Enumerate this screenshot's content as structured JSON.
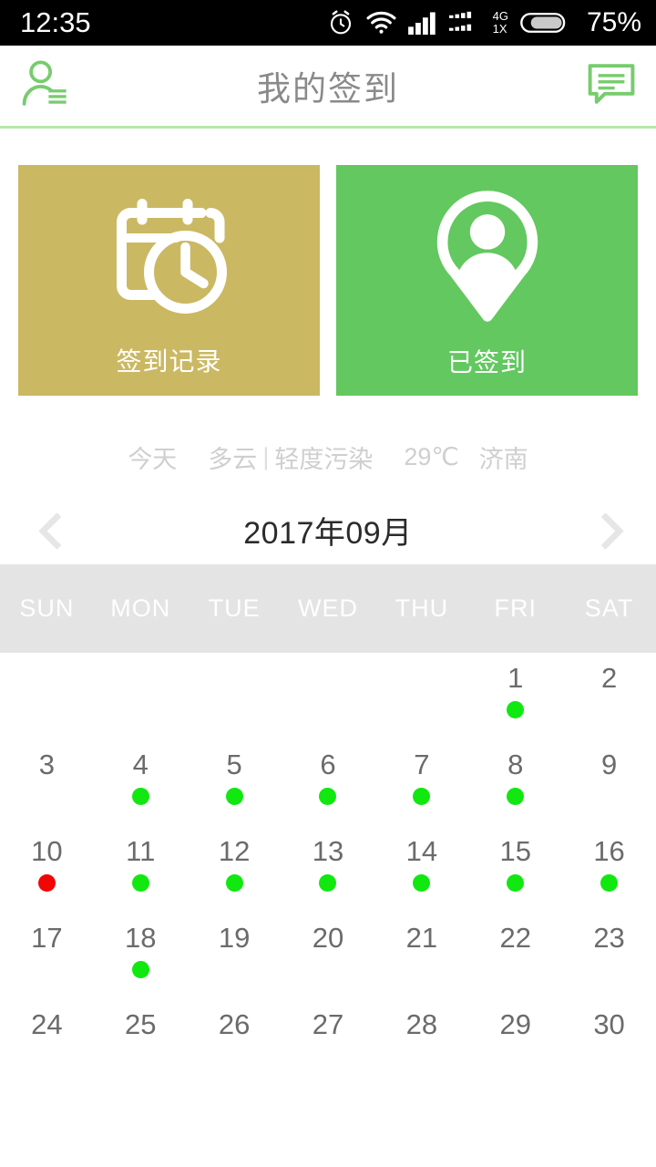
{
  "statusbar": {
    "time": "12:35",
    "network_type": "4G",
    "network_sub": "1X",
    "battery_percent": "75%",
    "icons": [
      "alarm-icon",
      "wifi-icon",
      "signal-icon",
      "signal-dual-icon",
      "battery-icon"
    ]
  },
  "header": {
    "title": "我的签到",
    "left_icon": "user-list-icon",
    "right_icon": "message-bubble-icon",
    "accent_color": "#b5e8ab"
  },
  "cards": [
    {
      "label": "签到记录",
      "icon": "calendar-clock-icon",
      "bg": "#cbb863"
    },
    {
      "label": "已签到",
      "icon": "map-pin-person-icon",
      "bg": "#62c85f"
    }
  ],
  "weather": {
    "day": "今天",
    "condition": "多云",
    "separator": "|",
    "air_quality": "轻度污染",
    "temperature": "29℃",
    "city": "济南"
  },
  "month_nav": {
    "prev_icon": "chevron-left-icon",
    "next_icon": "chevron-right-icon",
    "title": "2017年09月"
  },
  "calendar": {
    "weekdays": [
      "SUN",
      "MON",
      "TUE",
      "WED",
      "THU",
      "FRI",
      "SAT"
    ],
    "dot_colors": {
      "green": "#10e810",
      "red": "#f20505"
    },
    "cells": [
      {
        "num": "",
        "dot": "none"
      },
      {
        "num": "",
        "dot": "none"
      },
      {
        "num": "",
        "dot": "none"
      },
      {
        "num": "",
        "dot": "none"
      },
      {
        "num": "",
        "dot": "none"
      },
      {
        "num": "1",
        "dot": "green"
      },
      {
        "num": "2",
        "dot": "none"
      },
      {
        "num": "3",
        "dot": "none"
      },
      {
        "num": "4",
        "dot": "green"
      },
      {
        "num": "5",
        "dot": "green"
      },
      {
        "num": "6",
        "dot": "green"
      },
      {
        "num": "7",
        "dot": "green"
      },
      {
        "num": "8",
        "dot": "green"
      },
      {
        "num": "9",
        "dot": "none"
      },
      {
        "num": "10",
        "dot": "red"
      },
      {
        "num": "11",
        "dot": "green"
      },
      {
        "num": "12",
        "dot": "green"
      },
      {
        "num": "13",
        "dot": "green"
      },
      {
        "num": "14",
        "dot": "green"
      },
      {
        "num": "15",
        "dot": "green"
      },
      {
        "num": "16",
        "dot": "green"
      },
      {
        "num": "17",
        "dot": "none"
      },
      {
        "num": "18",
        "dot": "green"
      },
      {
        "num": "19",
        "dot": "none"
      },
      {
        "num": "20",
        "dot": "none"
      },
      {
        "num": "21",
        "dot": "none"
      },
      {
        "num": "22",
        "dot": "none"
      },
      {
        "num": "23",
        "dot": "none"
      },
      {
        "num": "24",
        "dot": "none"
      },
      {
        "num": "25",
        "dot": "none"
      },
      {
        "num": "26",
        "dot": "none"
      },
      {
        "num": "27",
        "dot": "none"
      },
      {
        "num": "28",
        "dot": "none"
      },
      {
        "num": "29",
        "dot": "none"
      },
      {
        "num": "30",
        "dot": "none"
      }
    ]
  }
}
